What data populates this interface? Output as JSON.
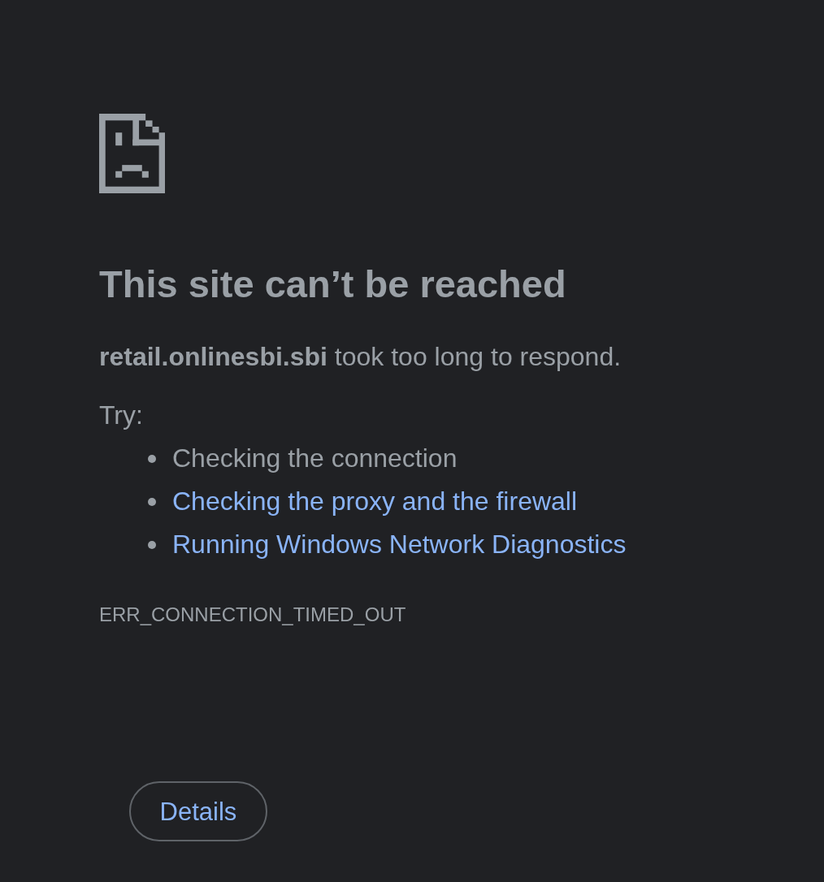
{
  "heading": "This site can’t be reached",
  "message": "**retail.onlinesbi.sbi** took too long to respond.",
  "try_label": "Try:",
  "suggestions": [
    {
      "kind": "text",
      "text": "Checking the connection"
    },
    {
      "kind": "link",
      "text": "Checking the proxy and the firewall"
    },
    {
      "kind": "link",
      "text": "Running Windows Network Diagnostics"
    }
  ],
  "error_code": "ERR_CONNECTION_TIMED_OUT",
  "details_button": {
    "label": "Details"
  }
}
